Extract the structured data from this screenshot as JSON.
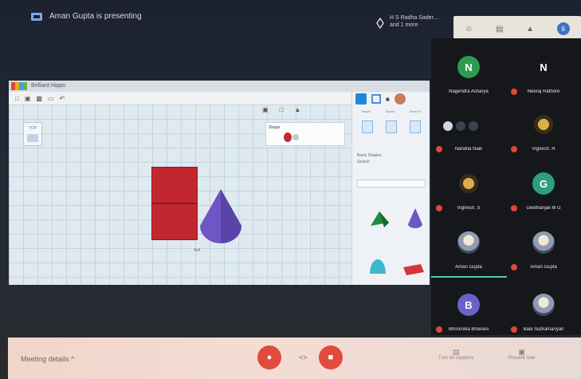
{
  "topbar": {
    "presenting_text": "Aman Gupta is presenting",
    "presenter_name": "H S Radha Sader...",
    "presenter_sub": "and 1 more",
    "badge": "9"
  },
  "app": {
    "title": "Brilliant Hippo",
    "toolbar_icons": [
      "copy-icon",
      "paste-icon",
      "duplicate-icon",
      "delete-icon",
      "undo-icon"
    ],
    "shape_panel_title": "Shape",
    "viewcube_label": "TOP",
    "dimension_label": "4x4",
    "right_panel_labels": [
      "Import",
      "Export",
      "Send To"
    ],
    "right_panel_sub": [
      "Basic Shapes",
      "Search"
    ]
  },
  "participants": [
    {
      "name": "Nagendra Acharya",
      "initial": "N",
      "color": "#2e9b4f",
      "muted": false
    },
    {
      "name": "Neeraj Rathore",
      "initial": "N",
      "color": "#15171b",
      "muted": true
    },
    {
      "name": "Nandita Naik",
      "initial": "",
      "color": "",
      "muted": true
    },
    {
      "name": "Vignesh. R",
      "initial": "",
      "color": "",
      "muted": true
    },
    {
      "name": "Vignesh. S",
      "initial": "",
      "color": "",
      "muted": true
    },
    {
      "name": "Geethanjali M G",
      "initial": "G",
      "color": "#2f9e7d",
      "muted": true
    },
    {
      "name": "Aman Gupta",
      "initial": "",
      "color": "",
      "muted": false
    },
    {
      "name": "Aman Gupta",
      "initial": "",
      "color": "",
      "muted": true
    },
    {
      "name": "Bhoomika Bhavani",
      "initial": "B",
      "color": "#6a62c9",
      "muted": true
    },
    {
      "name": "Bala Subramanyan",
      "initial": "",
      "color": "",
      "muted": true
    }
  ],
  "bottombar": {
    "meeting_details": "Meeting details",
    "chevron": "^",
    "mid_icon": "<>",
    "options": [
      "Turn on captions",
      "Present now"
    ]
  }
}
